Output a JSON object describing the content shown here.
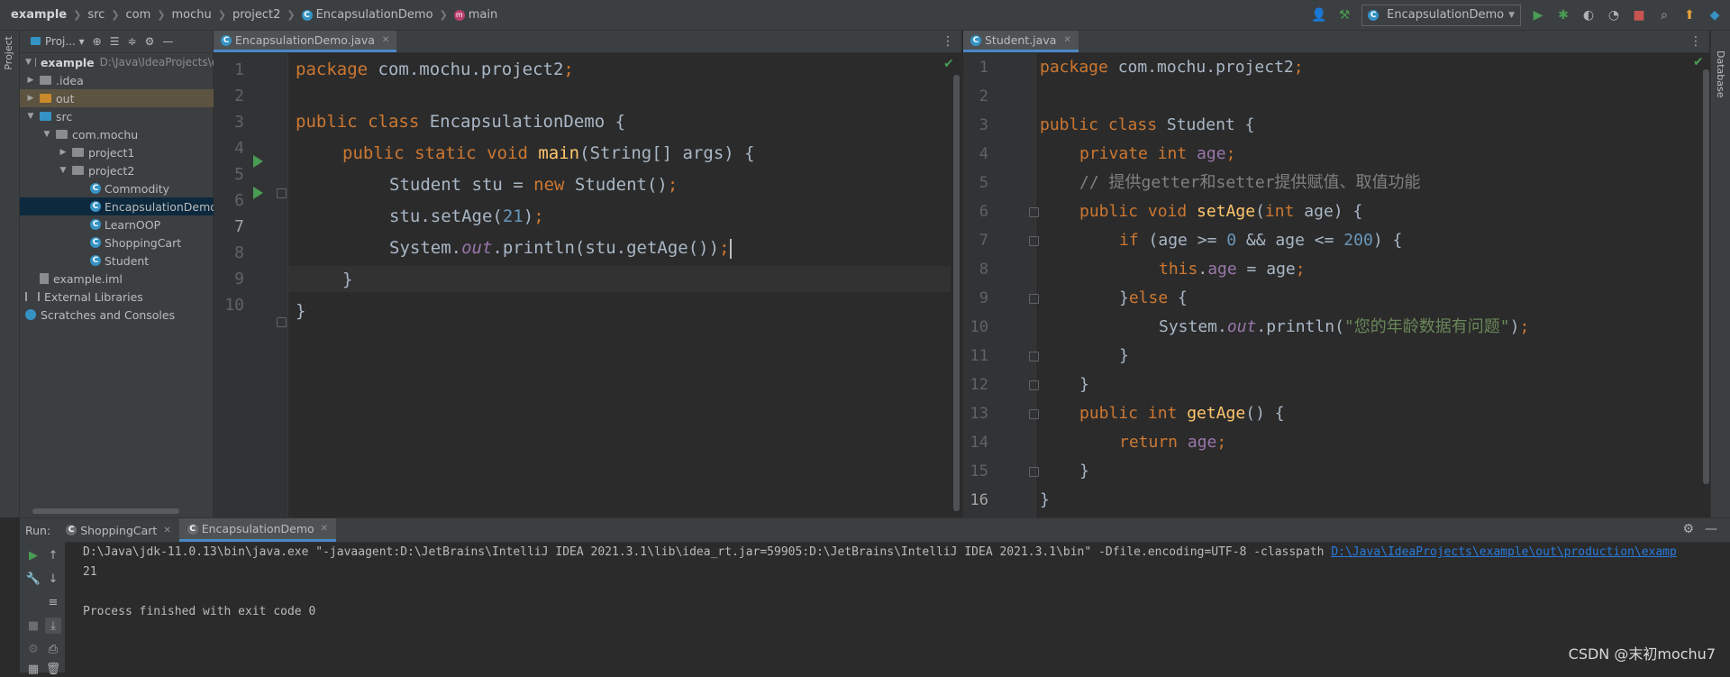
{
  "breadcrumb": {
    "items": [
      "example",
      "src",
      "com",
      "mochu",
      "project2",
      "EncapsulationDemo",
      "main"
    ]
  },
  "toolbar": {
    "run_config": "EncapsulationDemo"
  },
  "left_stripe": {
    "label": "Project"
  },
  "right_stripe": {
    "label": "Database"
  },
  "project_panel": {
    "header_label": "Proj...",
    "tree": [
      {
        "label": "example",
        "hint": "D:\\Java\\IdeaProjects\\e"
      },
      {
        "label": ".idea"
      },
      {
        "label": "out"
      },
      {
        "label": "src"
      },
      {
        "label": "com.mochu"
      },
      {
        "label": "project1"
      },
      {
        "label": "project2"
      },
      {
        "label": "Commodity"
      },
      {
        "label": "EncapsulationDemo"
      },
      {
        "label": "LearnOOP"
      },
      {
        "label": "ShoppingCart"
      },
      {
        "label": "Student"
      },
      {
        "label": "example.iml"
      },
      {
        "label": "External Libraries"
      },
      {
        "label": "Scratches and Consoles"
      }
    ]
  },
  "editor_left": {
    "tab_label": "EncapsulationDemo.java",
    "line_numbers": [
      "1",
      "2",
      "3",
      "4",
      "5",
      "6",
      "7",
      "8",
      "9",
      "10"
    ],
    "code": {
      "l1": {
        "kw": "package",
        "rest": " com.mochu.project2",
        "semi": ";"
      },
      "l3": {
        "kw": "public class",
        "rest": " EncapsulationDemo {"
      },
      "l4": {
        "kw1": "public static void",
        "fn": "main",
        "rest": "(String[] args) {"
      },
      "l5": {
        "a": "Student stu = ",
        "kw": "new",
        "b": " Student()",
        "semi": ";"
      },
      "l6": {
        "a": "stu.setAge(",
        "num": "21",
        "b": ")",
        "semi": ";"
      },
      "l7": {
        "a": "System.",
        "fld": "out",
        "b": ".println(stu.getAge())",
        "semi": ";"
      },
      "l8": {
        "a": "}"
      },
      "l9": {
        "a": "}"
      }
    }
  },
  "editor_right": {
    "tab_label": "Student.java",
    "line_numbers": [
      "1",
      "2",
      "3",
      "4",
      "5",
      "6",
      "7",
      "8",
      "9",
      "10",
      "11",
      "12",
      "13",
      "14",
      "15",
      "16"
    ],
    "code": {
      "l1": {
        "kw": "package",
        "rest": " com.mochu.project2",
        "semi": ";"
      },
      "l3": {
        "kw": "public class",
        "rest": " Student {"
      },
      "l4": {
        "kw": "private int",
        "fld": " age",
        "semi": ";"
      },
      "l5": {
        "cmt": "// 提供getter和setter提供赋值、取值功能"
      },
      "l6": {
        "kw": "public void",
        "fn": " setAge",
        "a": "(",
        "kw2": "int",
        "b": " age) {"
      },
      "l7": {
        "kw": "if",
        "a": " (age >= ",
        "num1": "0",
        "b": " && age <= ",
        "num2": "200",
        "c": ") {"
      },
      "l8": {
        "kw": "this",
        "a": ".",
        "fld": "age",
        "b": " = age",
        "semi": ";"
      },
      "l9": {
        "a": "}",
        "kw": "else",
        "b": " {"
      },
      "l10": {
        "a": "System.",
        "fld": "out",
        "b": ".println(",
        "str": "\"您的年龄数据有问题\"",
        "c": ")",
        "semi": ";"
      },
      "l11": {
        "a": "}"
      },
      "l12": {
        "a": "}"
      },
      "l13": {
        "kw": "public int",
        "fn": " getAge",
        "a": "() {"
      },
      "l14": {
        "kw": "return",
        "fld": " age",
        "semi": ";"
      },
      "l15": {
        "a": "}"
      },
      "l16": {
        "a": "}"
      }
    }
  },
  "run_panel": {
    "label": "Run:",
    "tabs": [
      "ShoppingCart",
      "EncapsulationDemo"
    ],
    "console": {
      "command": "D:\\Java\\jdk-11.0.13\\bin\\java.exe \"-javaagent:D:\\JetBrains\\IntelliJ IDEA 2021.3.1\\lib\\idea_rt.jar=59905:D:\\JetBrains\\IntelliJ IDEA 2021.3.1\\bin\" -Dfile.encoding=UTF-8 -classpath ",
      "classpath_link": "D:\\Java\\IdeaProjects\\example\\out\\production\\examp",
      "output": "21",
      "exit": "Process finished with exit code 0"
    }
  },
  "watermark": "CSDN @末初mochu7",
  "colors": {
    "keyword": "#cc7832",
    "function": "#ffc66d",
    "number": "#6897bb",
    "string": "#6a8759",
    "field": "#9876aa",
    "comment": "#808080",
    "run_green": "#499c54",
    "tab_underline": "#4a88c7"
  }
}
